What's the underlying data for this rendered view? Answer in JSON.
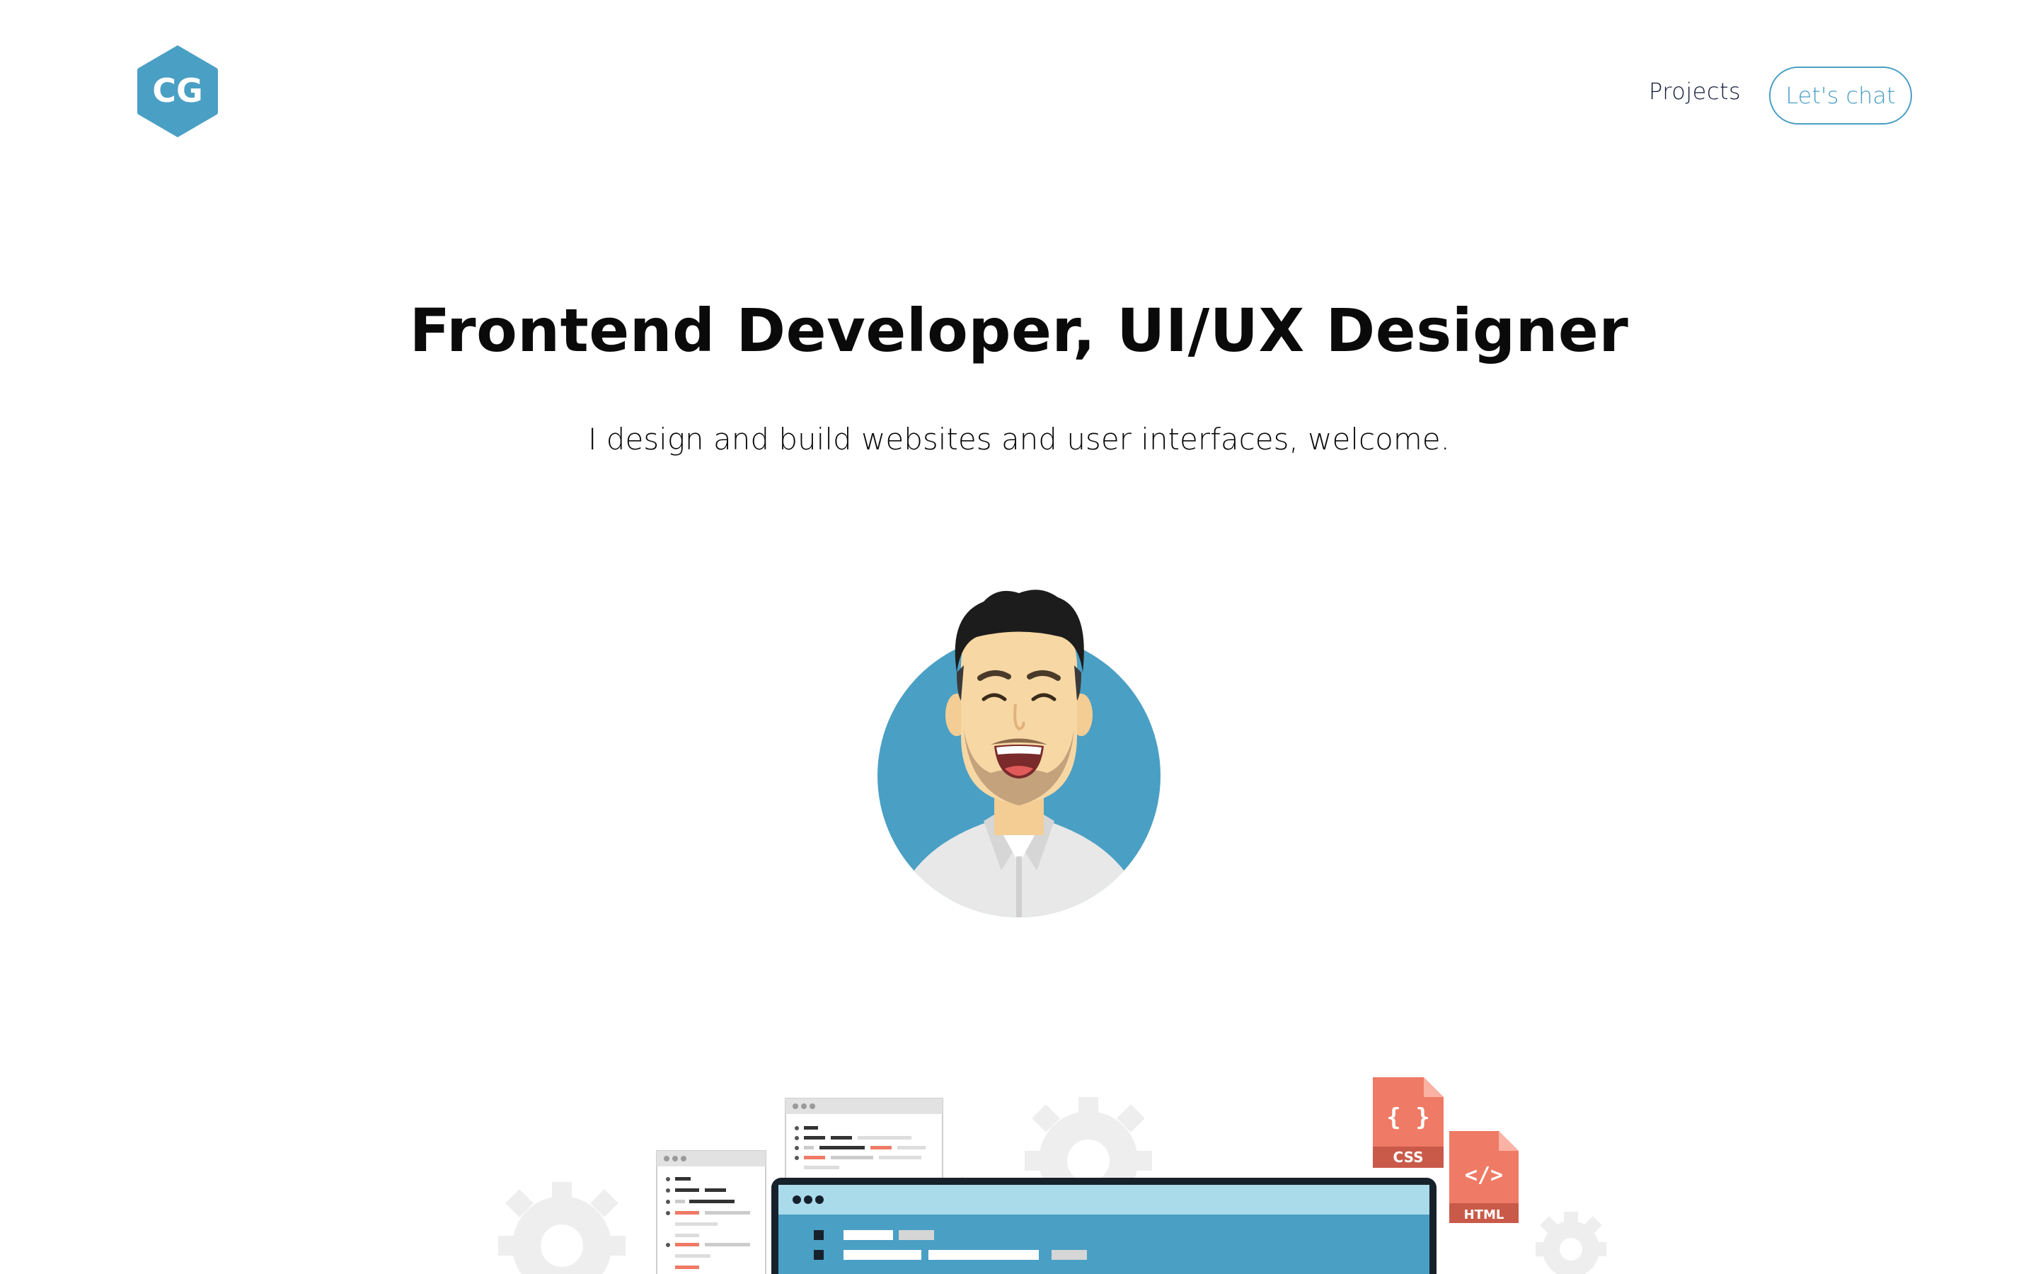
{
  "header": {
    "logo_text": "CG",
    "nav": {
      "projects_label": "Projects",
      "chat_label": "Let's chat"
    }
  },
  "hero": {
    "title": "Frontend Developer, UI/UX Designer",
    "subtitle": "I design and build websites and user interfaces, welcome."
  },
  "illustration": {
    "css_file_label": "CSS",
    "html_file_label": "HTML",
    "css_glyph": "{ }",
    "html_glyph": "</>"
  },
  "colors": {
    "accent": "#4a9fc4",
    "text_dark": "#0a0a0a",
    "file_red": "#ef7a65",
    "gear_gray": "#eeeeee",
    "monitor_dark": "#17212b"
  }
}
